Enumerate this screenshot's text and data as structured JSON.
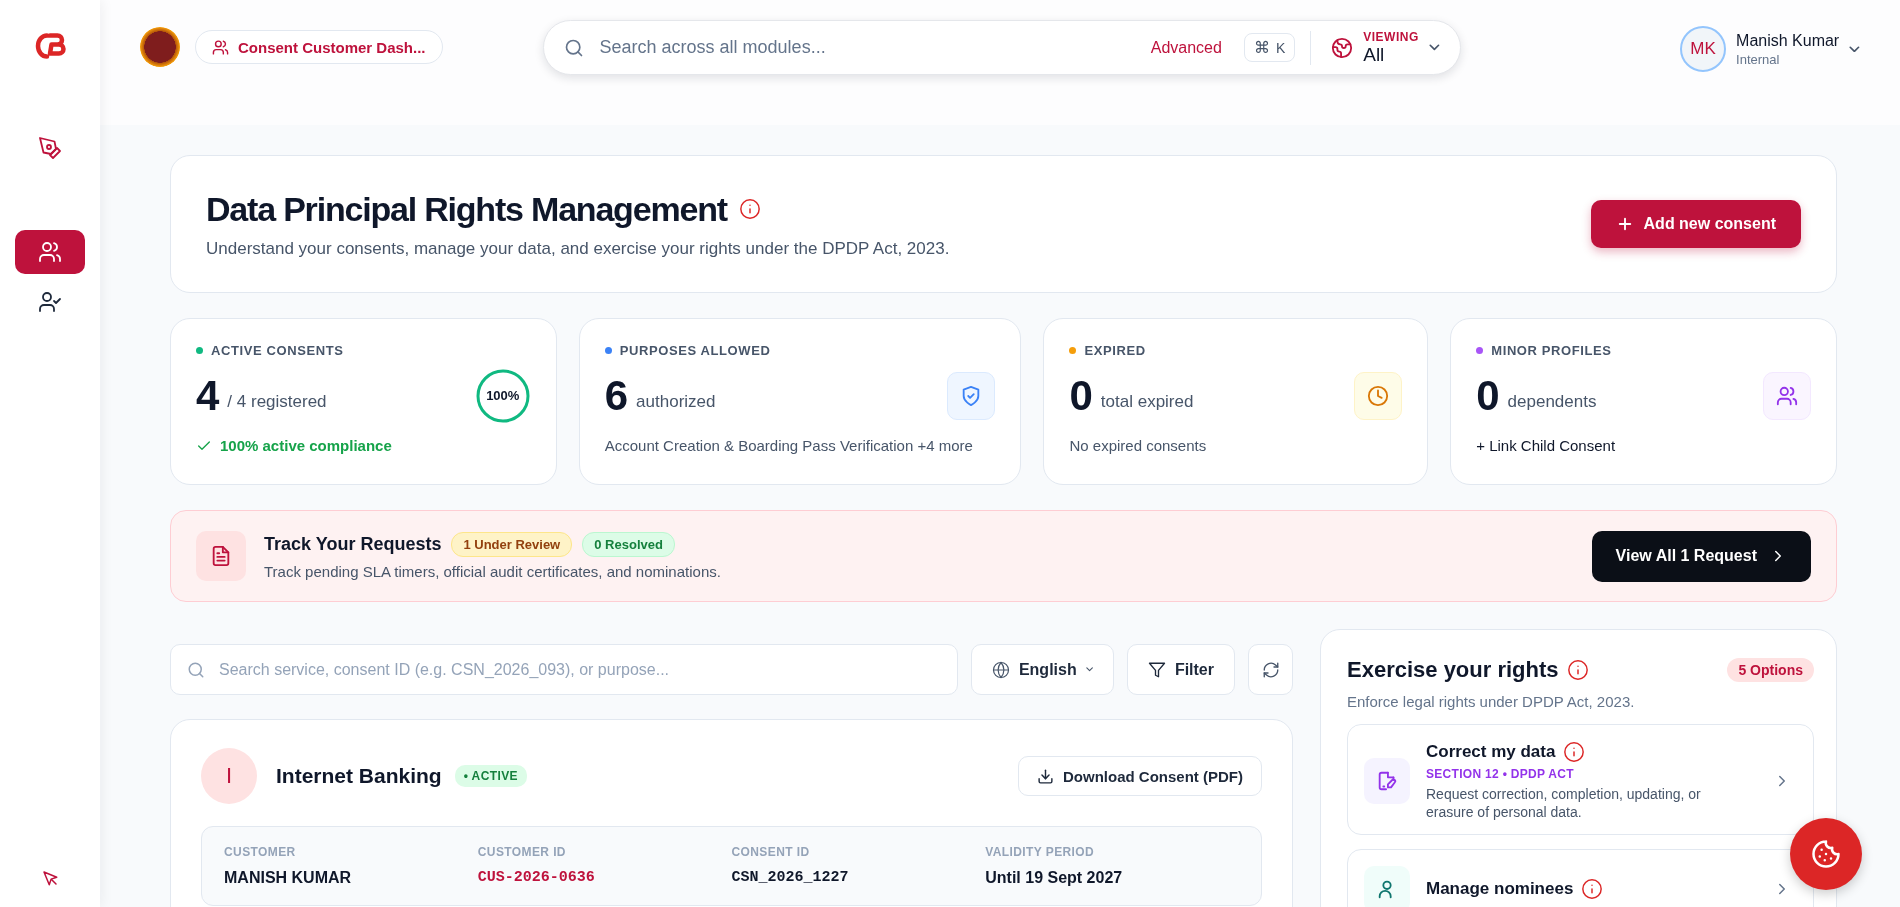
{
  "header": {
    "breadcrumb": "Consent Customer Dash...",
    "search": {
      "placeholder": "Search across all modules...",
      "advanced": "Advanced",
      "shortcut": [
        "⌘",
        "K"
      ],
      "viewing_label": "VIEWING",
      "viewing_value": "All"
    },
    "user": {
      "initials": "MK",
      "name": "Manish Kumar",
      "role": "Internal"
    }
  },
  "sidebar": {
    "items": [
      {
        "selected": false
      },
      {
        "selected": true
      },
      {
        "selected": false
      }
    ]
  },
  "hero": {
    "title": "Data Principal Rights Management",
    "subtitle": "Understand your consents, manage your data, and exercise your rights under the DPDP Act, 2023.",
    "button": "Add new consent"
  },
  "stats": [
    {
      "label": "ACTIVE CONSENTS",
      "color": "#10b981",
      "value": "4",
      "unit": "/ 4 registered",
      "kind": "ring",
      "ring_text": "100%",
      "level": 1,
      "footer": {
        "text": "100% active compliance",
        "kind": "success"
      }
    },
    {
      "label": "PURPOSES ALLOWED",
      "color": "#3b82f6",
      "value": "6",
      "unit": "authorized",
      "kind": "shield",
      "footer": {
        "text": "Account Creation & Boarding Pass Verification +4 more",
        "kind": "muted"
      }
    },
    {
      "label": "EXPIRED",
      "color": "#f59e0b",
      "value": "0",
      "unit": "total expired",
      "kind": "clock",
      "footer": {
        "text": "No expired consents",
        "kind": "muted"
      }
    },
    {
      "label": "MINOR PROFILES",
      "color": "#a855f7",
      "value": "0",
      "unit": "dependents",
      "kind": "users",
      "footer": {
        "text": "+ Link Child Consent",
        "kind": "link"
      }
    }
  ],
  "requests": {
    "title": "Track Your Requests",
    "badges": [
      {
        "text": "1 Under Review",
        "kind": "warning"
      },
      {
        "text": "0 Resolved",
        "kind": "success"
      }
    ],
    "description": "Track pending SLA timers, official audit certificates, and nominations.",
    "button": "View All 1 Request"
  },
  "toolbar": {
    "search_placeholder": "Search service, consent ID (e.g. CSN_2026_093), or purpose...",
    "language": "English",
    "filter": "Filter"
  },
  "consents": [
    {
      "initial": "I",
      "name": "Internet Banking",
      "status": "• ACTIVE",
      "download": "Download Consent (PDF)",
      "fields": [
        {
          "label": "CUSTOMER",
          "value": "MANISH KUMAR",
          "kind": "plain"
        },
        {
          "label": "CUSTOMER ID",
          "value": "CUS-2026-0636",
          "kind": "code-accent"
        },
        {
          "label": "CONSENT ID",
          "value": "CSN_2026_1227",
          "kind": "code"
        },
        {
          "label": "VALIDITY PERIOD",
          "value": "Until 19 Sept 2027",
          "kind": "plain"
        }
      ]
    }
  ],
  "rights": {
    "title": "Exercise your rights",
    "badge": "5 Options",
    "subtitle": "Enforce legal rights under DPDP Act, 2023.",
    "options": [
      {
        "title": "Correct my data",
        "section": "SECTION 12 • DPDP ACT",
        "description": "Request correction, completion, updating, or erasure of personal data.",
        "kind": "edit"
      },
      {
        "title": "Manage nominees",
        "kind": "nominee"
      }
    ]
  }
}
